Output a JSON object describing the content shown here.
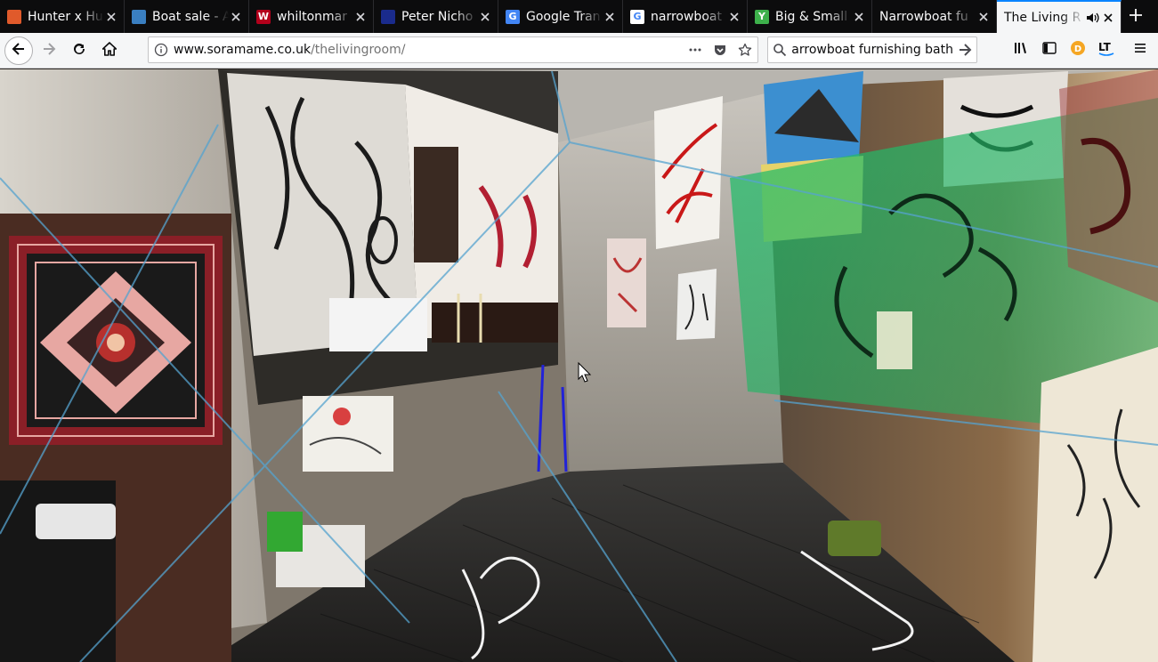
{
  "tabs": [
    {
      "title": "Hunter x Hu",
      "favicon": "leaf-icon",
      "fav_color": "#e05a2b"
    },
    {
      "title": "Boat sale - A",
      "favicon": "boat-icon",
      "fav_color": "#3a7fc1"
    },
    {
      "title": "whiltonmar",
      "favicon": "w-logo-icon",
      "fav_color": "#b3001b",
      "fav_text": "W"
    },
    {
      "title": "Peter Nicho",
      "favicon": "flag-icon",
      "fav_color": "#1a2b8c"
    },
    {
      "title": "Google Tran",
      "favicon": "translate-icon",
      "fav_color": "#4285f4",
      "fav_text": "G"
    },
    {
      "title": "narrowboat",
      "favicon": "google-icon",
      "fav_color": "#ffffff",
      "fav_text": "G"
    },
    {
      "title": "Big & Small",
      "favicon": "y-logo-icon",
      "fav_color": "#3db04b",
      "fav_text": "Y"
    },
    {
      "title": "Narrowboat fu",
      "favicon": "",
      "fav_color": ""
    },
    {
      "title": "The Living R",
      "favicon": "",
      "fav_color": "",
      "active": true,
      "audio": true
    }
  ],
  "navbar": {
    "url_host": "www.soramame.co.uk",
    "url_path": "/thelivingroom/",
    "search_value": "narrowboat furnishing bath"
  },
  "icons": {
    "back": "back-arrow-icon",
    "forward": "forward-arrow-icon",
    "reload": "reload-icon",
    "home": "home-icon",
    "library": "library-icon",
    "sidebar": "sidebar-icon",
    "menu": "hamburger-menu-icon"
  },
  "colors": {
    "tabstrip_bg": "#0c0c0d",
    "active_tab_accent": "#0a84ff",
    "toolbar_bg": "#f5f6f7"
  }
}
